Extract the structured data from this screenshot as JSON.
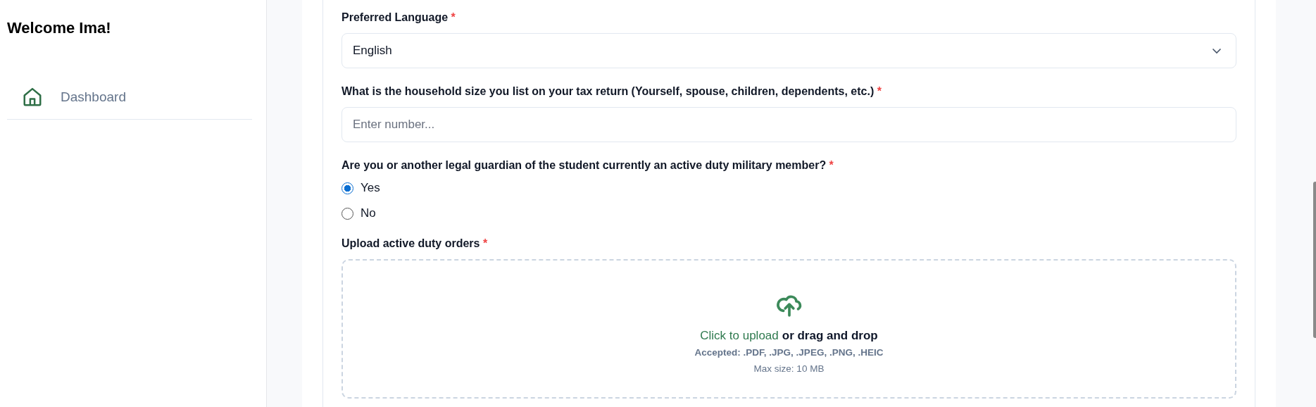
{
  "sidebar": {
    "greeting": "Welcome Ima!",
    "items": [
      {
        "label": "Dashboard",
        "selected": false
      }
    ]
  },
  "form": {
    "fields": [
      {
        "kind": "select",
        "label": "Preferred Language",
        "required_mark": "*",
        "value": "English"
      },
      {
        "kind": "input",
        "label": "What is the household size you list on your tax return (Yourself, spouse, children, dependents, etc.)",
        "required_mark": "*",
        "placeholder": "Enter number..."
      },
      {
        "kind": "radio",
        "label": "Are you or another legal guardian of the student currently an active duty military member?",
        "required_mark": "*",
        "options": [
          {
            "label": "Yes",
            "selected": true
          },
          {
            "label": "No",
            "selected": false
          }
        ]
      },
      {
        "kind": "upload",
        "label": "Upload active duty orders",
        "required_mark": "*",
        "link": "Click to upload",
        "text": "or drag and drop",
        "accepted": "Accepted: .PDF, .JPG, .JPEG, .PNG, .HEIC",
        "max_size": "Max size: 10 MB"
      }
    ]
  }
}
